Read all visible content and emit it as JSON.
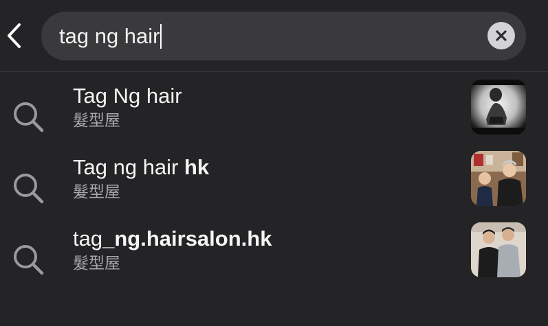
{
  "search": {
    "query": "tag ng hair"
  },
  "results": [
    {
      "title_plain": "Tag Ng hair",
      "title_bold": "",
      "subtitle": "髮型屋"
    },
    {
      "title_plain": "Tag ng hair ",
      "title_bold": "hk",
      "subtitle": "髮型屋"
    },
    {
      "title_plain": "tag",
      "title_bold": "_ng.hairsalon.hk",
      "subtitle": "髮型屋"
    }
  ],
  "icons": {
    "back": "chevron-left-icon",
    "clear": "clear-icon",
    "result": "search-icon"
  },
  "colors": {
    "background": "#242426",
    "search_field": "#3a3a3c",
    "secondary_text": "#a7a7aa",
    "icon_gray": "#9a9a9e"
  }
}
